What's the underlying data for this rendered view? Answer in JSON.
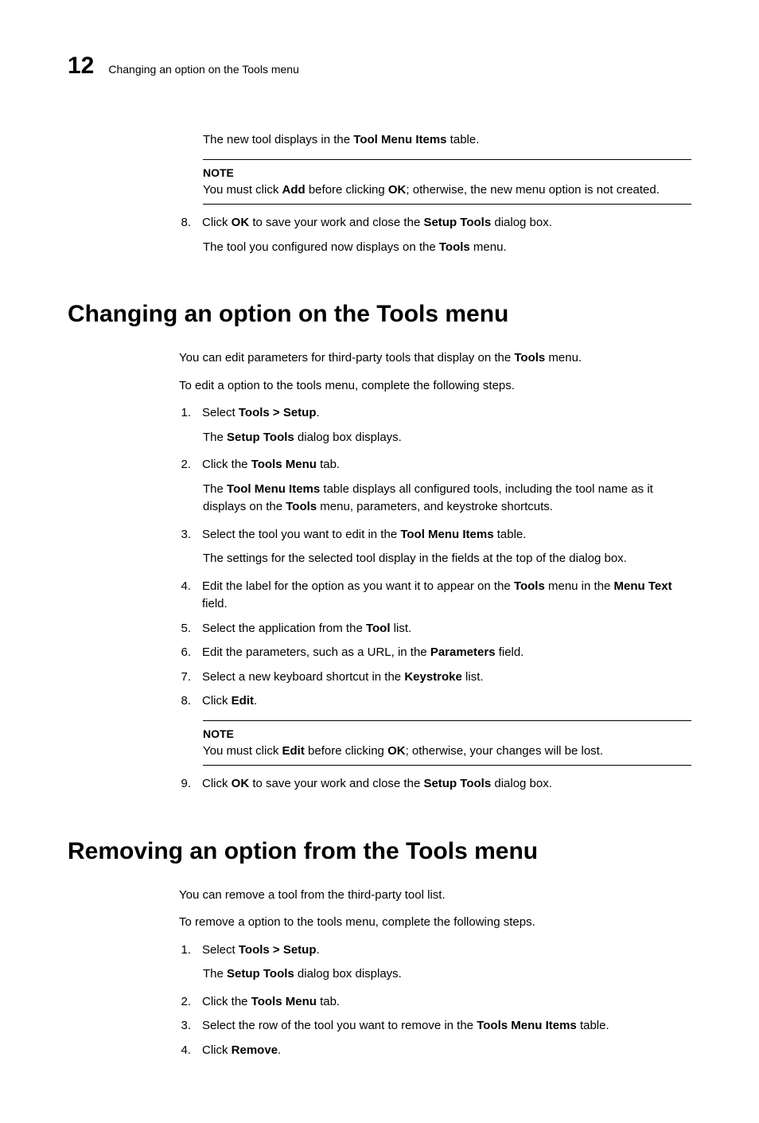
{
  "header": {
    "pageNumber": "12",
    "runningTitle": "Changing an option on the Tools menu"
  },
  "intro": {
    "line1a": "The new tool displays in the ",
    "line1b": "Tool Menu Items",
    "line1c": " table."
  },
  "note1": {
    "label": "NOTE",
    "a": "You must click ",
    "b": "Add",
    "c": " before clicking ",
    "d": "OK",
    "e": "; otherwise, the new menu option is not created."
  },
  "step8": {
    "n": "8.",
    "a": "Click ",
    "b": "OK",
    "c": " to save your work and close the ",
    "d": "Setup Tools",
    "e": " dialog box.",
    "subA": "The tool you configured now displays on the ",
    "subB": "Tools",
    "subC": " menu."
  },
  "sec1": {
    "title": "Changing an option on the Tools menu",
    "p1a": "You can edit parameters for third-party tools that display on the ",
    "p1b": "Tools",
    "p1c": " menu.",
    "p2": "To edit a option to the tools menu, complete the following steps.",
    "s1": {
      "n": "1.",
      "a": "Select ",
      "b": "Tools > Setup",
      "c": ".",
      "suba": "The ",
      "subb": "Setup Tools",
      "subc": " dialog box displays."
    },
    "s2": {
      "n": "2.",
      "a": "Click the ",
      "b": "Tools Menu",
      "c": " tab.",
      "suba": "The ",
      "subb": "Tool Menu Items",
      "subc": " table displays all configured tools, including the tool name as it displays on the ",
      "subd": "Tools",
      "sube": " menu, parameters, and keystroke shortcuts."
    },
    "s3": {
      "n": "3.",
      "a": "Select the tool you want to edit in the ",
      "b": "Tool Menu Items",
      "c": " table.",
      "sub": "The settings for the selected tool display in the fields at the top of the dialog box."
    },
    "s4": {
      "n": "4.",
      "a": "Edit the label for the option as you want it to appear on the ",
      "b": "Tools",
      "c": " menu in the ",
      "d": "Menu Text",
      "e": " field."
    },
    "s5": {
      "n": "5.",
      "a": "Select the application from the ",
      "b": "Tool",
      "c": " list."
    },
    "s6": {
      "n": "6.",
      "a": "Edit the parameters, such as a URL, in the ",
      "b": "Parameters",
      "c": " field."
    },
    "s7": {
      "n": "7.",
      "a": "Select a new keyboard shortcut in the ",
      "b": "Keystroke",
      "c": " list."
    },
    "s8": {
      "n": "8.",
      "a": "Click ",
      "b": "Edit",
      "c": "."
    },
    "note": {
      "label": "NOTE",
      "a": "You must click ",
      "b": "Edit",
      "c": " before clicking ",
      "d": "OK",
      "e": "; otherwise, your changes will be lost."
    },
    "s9": {
      "n": "9.",
      "a": "Click ",
      "b": "OK",
      "c": " to save your work and close the ",
      "d": "Setup Tools",
      "e": " dialog box."
    }
  },
  "sec2": {
    "title": "Removing an option from the Tools menu",
    "p1": "You can remove a tool from the third-party tool list.",
    "p2": "To remove a option to the tools menu, complete the following steps.",
    "s1": {
      "n": "1.",
      "a": "Select ",
      "b": "Tools > Setup",
      "c": ".",
      "suba": "The ",
      "subb": "Setup Tools",
      "subc": " dialog box displays."
    },
    "s2": {
      "n": "2.",
      "a": "Click the ",
      "b": "Tools Menu",
      "c": " tab."
    },
    "s3": {
      "n": "3.",
      "a": "Select the row of the tool you want to remove in the ",
      "b": "Tools Menu Items",
      "c": " table."
    },
    "s4": {
      "n": "4.",
      "a": "Click ",
      "b": "Remove",
      "c": "."
    }
  }
}
